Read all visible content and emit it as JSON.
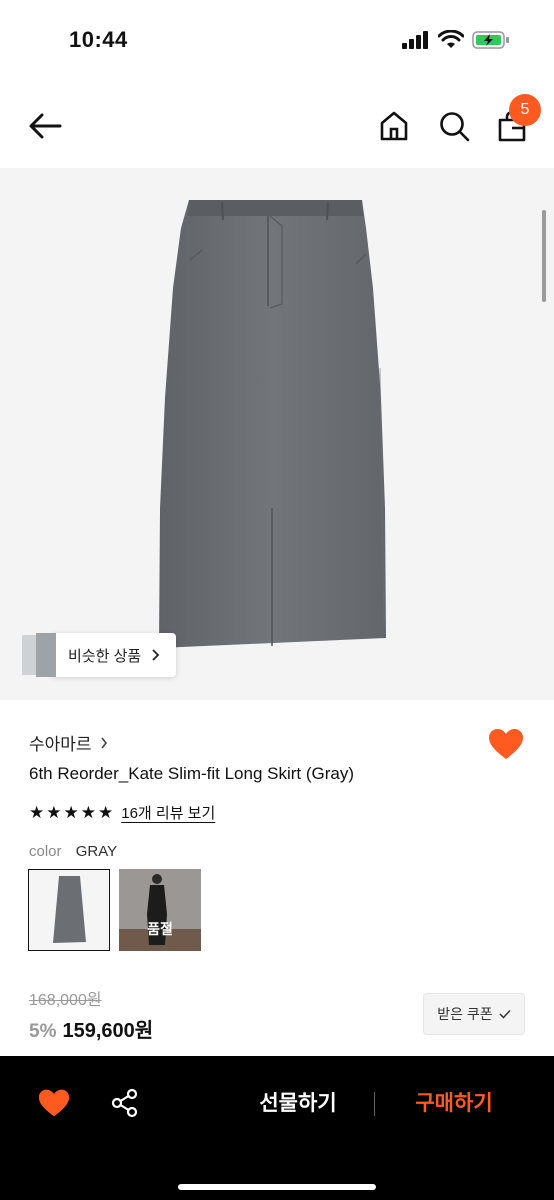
{
  "status_bar": {
    "time": "10:44"
  },
  "nav": {
    "cart_count": "5"
  },
  "hero": {
    "similar_label": "비슷한 상품"
  },
  "product": {
    "brand": "수아마르",
    "title": "6th Reorder_Kate Slim-fit Long Skirt (Gray)",
    "rating_stars": 5,
    "review_link": "16개 리뷰 보기",
    "color_label": "color",
    "color_value": "GRAY",
    "soldout_label": "품절",
    "original_price": "168,000원",
    "discount": "5%",
    "price": "159,600원",
    "coupon_label": "받은 쿠폰"
  },
  "bottom_bar": {
    "gift_label": "선물하기",
    "buy_label": "구매하기"
  },
  "colors": {
    "accent": "#ff5a1f",
    "skirt_gray": "#6b6f74",
    "bottom_bar_bg": "#000000"
  },
  "icons": [
    "back-arrow-icon",
    "home-icon",
    "search-icon",
    "shopping-bag-icon",
    "heart-icon",
    "share-icon",
    "chevron-right-icon",
    "check-icon",
    "star-icon"
  ]
}
